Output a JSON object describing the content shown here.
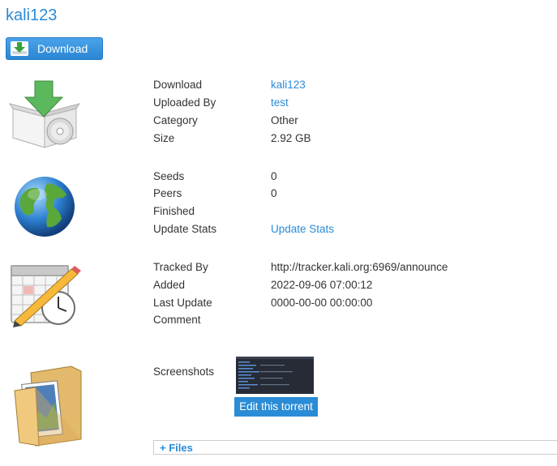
{
  "page": {
    "title": "kali123"
  },
  "download_button": {
    "label": "Download"
  },
  "details": {
    "download_label": "Download",
    "download_value": "kali123",
    "uploaded_by_label": "Uploaded By",
    "uploaded_by_value": "test",
    "category_label": "Category",
    "category_value": "Other",
    "size_label": "Size",
    "size_value": "2.92 GB"
  },
  "stats": {
    "seeds_label": "Seeds",
    "seeds_value": "0",
    "peers_label": "Peers",
    "peers_value": "0",
    "finished_label": "Finished",
    "finished_value": "",
    "update_stats_label": "Update Stats",
    "update_stats_link": "Update Stats"
  },
  "tracking": {
    "tracked_by_label": "Tracked By",
    "tracked_by_value": "http://tracker.kali.org:6969/announce",
    "added_label": "Added",
    "added_value": "2022-09-06 07:00:12",
    "last_update_label": "Last Update",
    "last_update_value": "0000-00-00 00:00:00",
    "comment_label": "Comment",
    "comment_value": ""
  },
  "screenshots": {
    "label": "Screenshots",
    "edit_button": "Edit this torrent"
  },
  "files": {
    "toggle_label": "+ Files"
  },
  "colors": {
    "link": "#2a8bd6",
    "text": "#333333",
    "button": "#2a8bd6"
  },
  "icons": {
    "download_button_icon": "download-arrow-icon",
    "details_icon": "package-disc-icon",
    "stats_icon": "globe-icon",
    "tracking_icon": "calendar-clock-pencil-icon",
    "screenshots_icon": "folder-images-icon"
  }
}
